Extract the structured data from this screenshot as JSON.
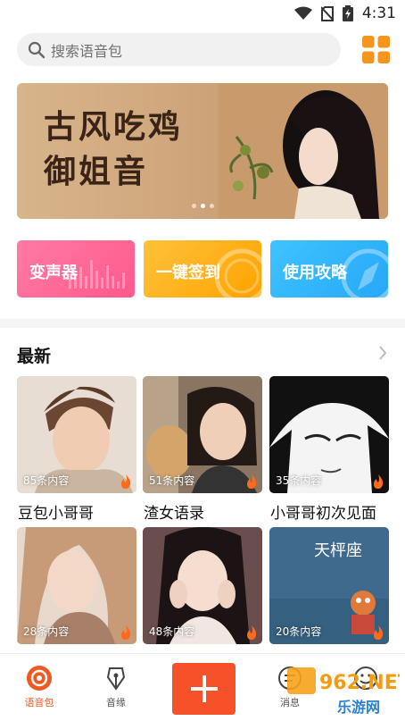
{
  "status_bar": {
    "time": "4:31"
  },
  "search": {
    "placeholder": "搜索语音包"
  },
  "banner": {
    "title_line1": "古风吃鸡",
    "title_line2": "御姐音",
    "slide_count": 3,
    "active_slide": 2
  },
  "quick_actions": [
    {
      "label": "变声器",
      "color": "#ff6699"
    },
    {
      "label": "一键签到",
      "color": "#ffb21a"
    },
    {
      "label": "使用攻略",
      "color": "#33b5fb"
    }
  ],
  "section": {
    "title": "最新"
  },
  "cards": [
    {
      "count": "85条内容",
      "name": "豆包小哥哥"
    },
    {
      "count": "51条内容",
      "name": "渣女语录"
    },
    {
      "count": "35条内容",
      "name": "小哥哥初次见面"
    },
    {
      "count": "28条内容",
      "name": ""
    },
    {
      "count": "48条内容",
      "name": ""
    },
    {
      "count": "20条内容",
      "name": "",
      "thumb_text": "天枰座"
    }
  ],
  "nav": {
    "tabs": [
      {
        "label": "语音包",
        "icon": "voice-pack-icon",
        "active": true
      },
      {
        "label": "音缘",
        "icon": "pen-nib-icon",
        "active": false
      },
      {
        "label": "消息",
        "icon": "message-icon",
        "active": false
      },
      {
        "label": "",
        "icon": "smile-icon",
        "active": false
      }
    ],
    "add_icon": "plus-icon"
  },
  "watermark": {
    "text_main": "962.NET",
    "text_sub": "乐游网"
  },
  "colors": {
    "accent": "#f5522a",
    "active_tab": "#f05a22"
  }
}
